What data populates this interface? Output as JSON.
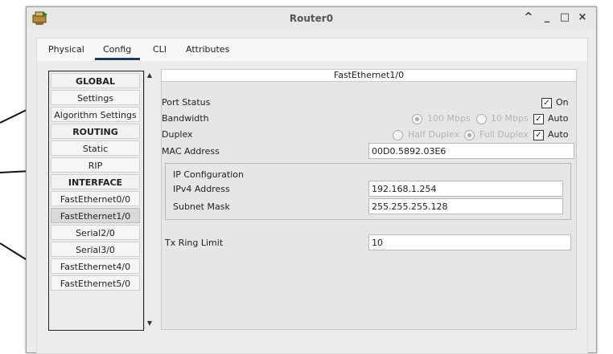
{
  "window": {
    "title": "Router0"
  },
  "window_buttons": {
    "collapse": "^",
    "minimize": "_",
    "maximize": "□",
    "close": "×"
  },
  "tabs": [
    "Physical",
    "Config",
    "CLI",
    "Attributes"
  ],
  "nav": {
    "items": [
      "GLOBAL",
      "Settings",
      "Algorithm Settings",
      "ROUTING",
      "Static",
      "RIP",
      "INTERFACE",
      "FastEthernet0/0",
      "FastEthernet1/0",
      "Serial2/0",
      "Serial3/0",
      "FastEthernet4/0",
      "FastEthernet5/0"
    ],
    "selected": "FastEthernet1/0"
  },
  "scroll": {
    "up": "▲",
    "down": "▼"
  },
  "panel": {
    "title": "FastEthernet1/0",
    "port_status_label": "Port Status",
    "on_label": "On",
    "bandwidth_label": "Bandwidth",
    "bw_100": "100 Mbps",
    "bw_10": "10 Mbps",
    "auto_label": "Auto",
    "duplex_label": "Duplex",
    "half_duplex": "Half Duplex",
    "full_duplex": "Full Duplex",
    "mac_label": "MAC Address",
    "mac_value": "00D0.5892.03E6",
    "ip_config_label": "IP Configuration",
    "ipv4_label": "IPv4 Address",
    "ipv4_value": "192.168.1.254",
    "mask_label": "Subnet Mask",
    "mask_value": "255.255.255.128",
    "tx_label": "Tx Ring Limit",
    "tx_value": "10",
    "check_mark": "✓"
  },
  "colors": {
    "tab_underline": "#1f3a5a",
    "selected_nav": "#d9d9d9"
  }
}
